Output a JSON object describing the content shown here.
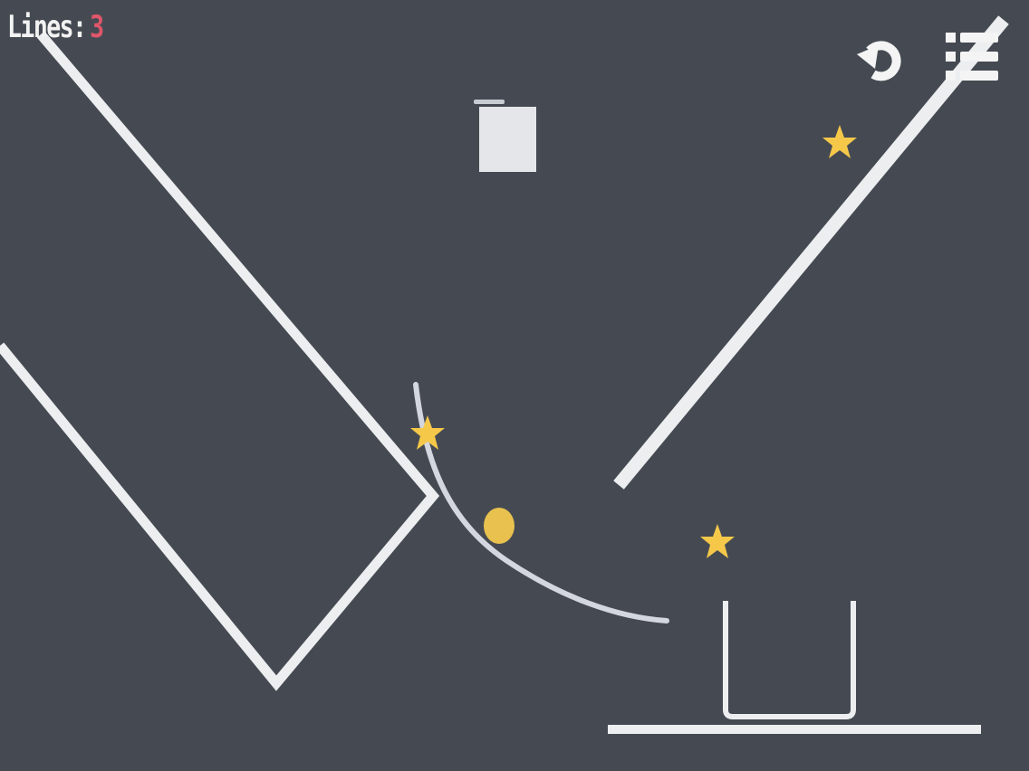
{
  "hud": {
    "lines_label": "Lines:",
    "lines_count": "3"
  },
  "toolbar": {
    "undo_icon": "undo-icon",
    "menu_icon": "level-menu-icon"
  },
  "colors": {
    "background": "#454a52",
    "wall": "#eceef0",
    "drawn_line": "#d4d7df",
    "star": "#f5c84a",
    "ball": "#e8c14f",
    "lines_count": "#e0566a"
  }
}
